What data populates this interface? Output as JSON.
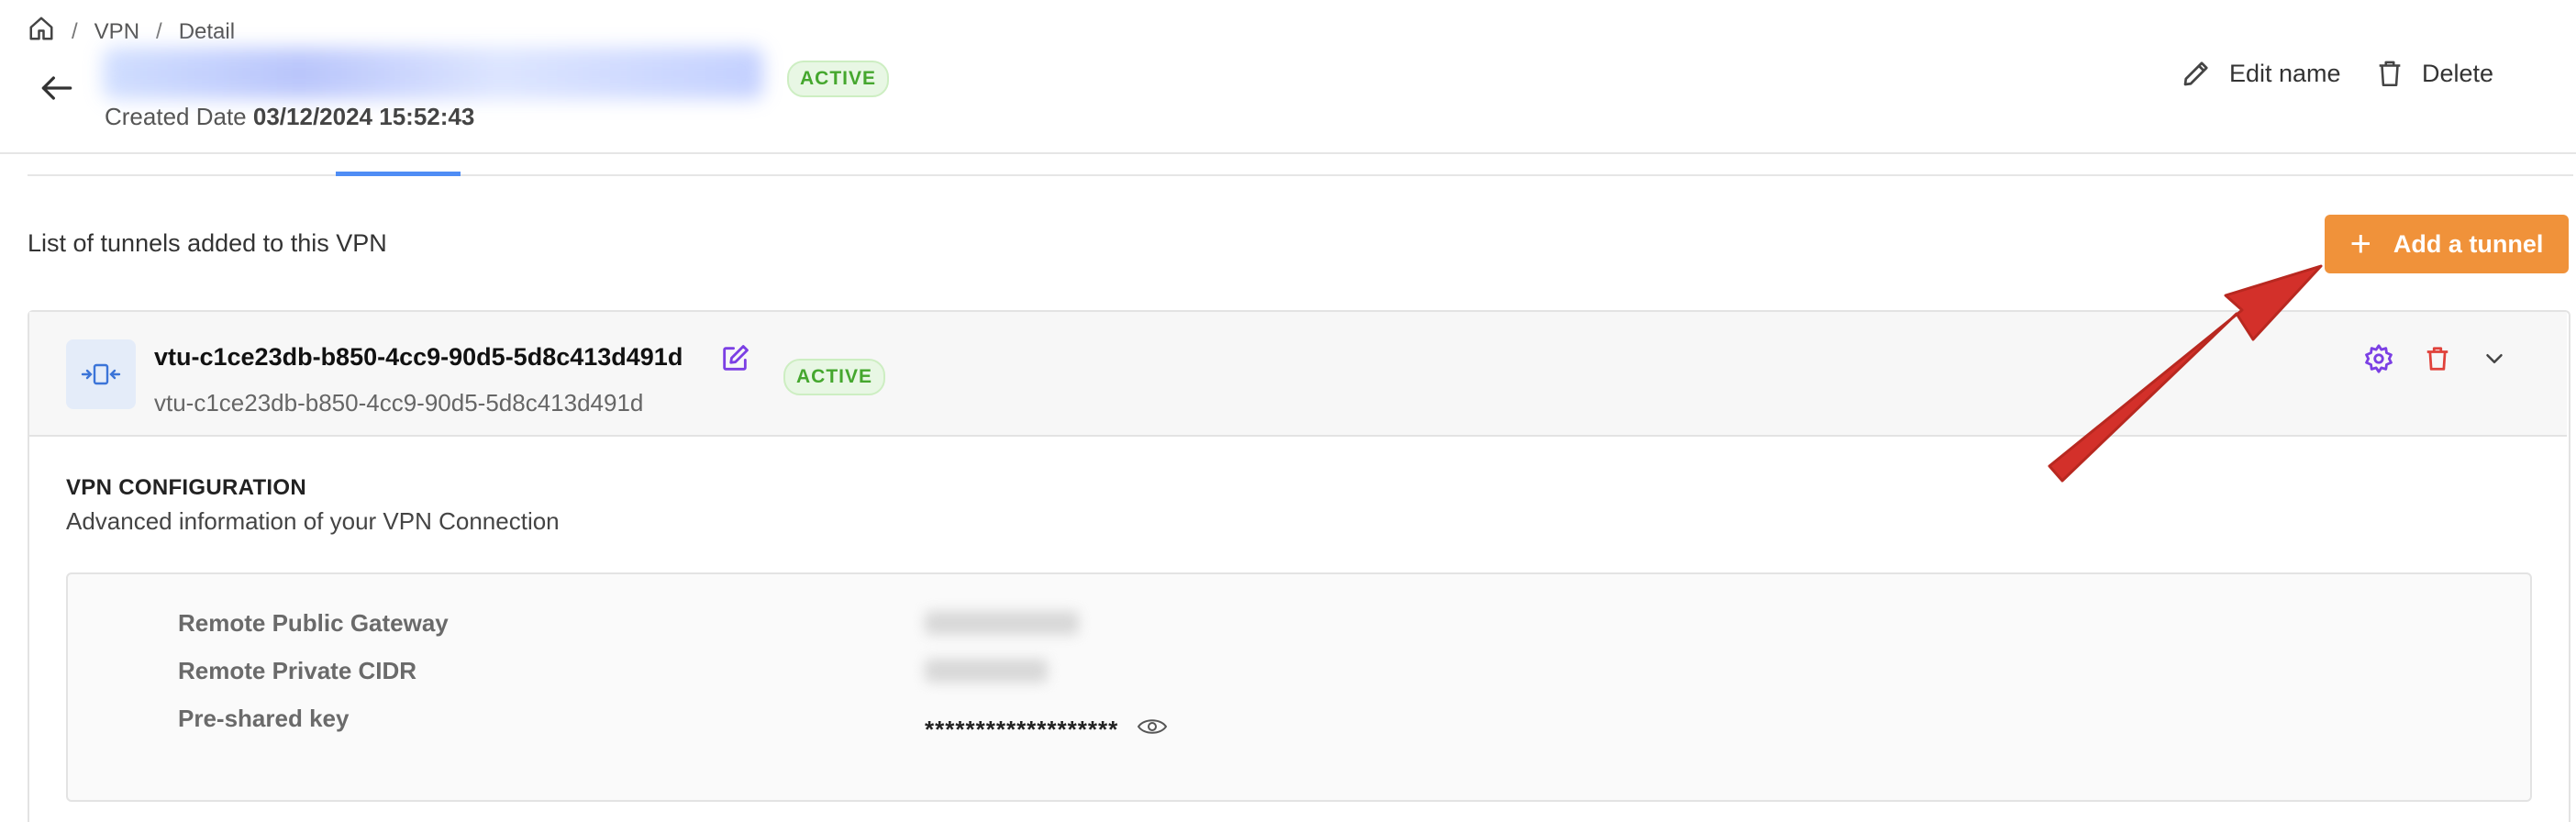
{
  "breadcrumb": {
    "home_icon": "home-icon",
    "items": [
      "VPN",
      "Detail"
    ],
    "separator": "/"
  },
  "header": {
    "status": "ACTIVE",
    "created_label": "Created Date",
    "created_value": "03/12/2024 15:52:43",
    "edit_name": "Edit name",
    "delete": "Delete"
  },
  "tunnels": {
    "list_title": "List of tunnels added to this VPN",
    "add_button": "Add a tunnel",
    "item": {
      "name": "vtu-c1ce23db-b850-4cc9-90d5-5d8c413d491d",
      "subtitle": "vtu-c1ce23db-b850-4cc9-90d5-5d8c413d491d",
      "status": "ACTIVE"
    }
  },
  "config": {
    "title": "VPN CONFIGURATION",
    "subtitle": "Advanced information of your VPN Connection",
    "rows": [
      {
        "label": "Remote Public Gateway"
      },
      {
        "label": "Remote Private CIDR"
      },
      {
        "label": "Pre-shared key",
        "value": "*******************"
      }
    ]
  },
  "colors": {
    "accent": "#f0923a",
    "active_text": "#45a72e",
    "active_bg": "#e8f7e4",
    "tab_active": "#4f8df5",
    "arrow": "#d3302a",
    "edit_icon": "#7b3fe4",
    "delete_icon": "#e0413a"
  }
}
